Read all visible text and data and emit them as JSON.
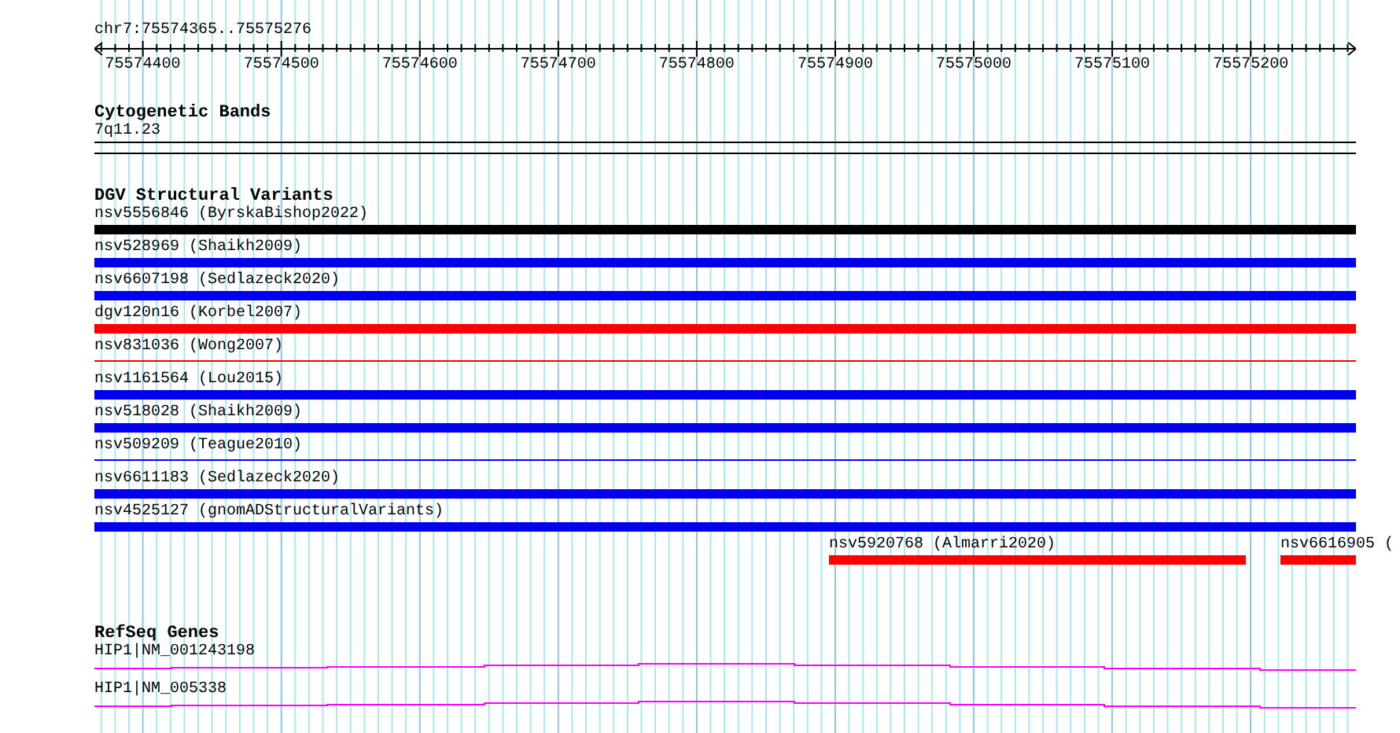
{
  "ruler": {
    "title": "chr7:75574365..75575276",
    "ticks": [
      "75574400",
      "75574500",
      "75574600",
      "75574700",
      "75574800",
      "75574900",
      "75575000",
      "75575100",
      "75575200"
    ]
  },
  "cytogenetic_bands": {
    "title": "Cytogenetic Bands",
    "band": "7q11.23"
  },
  "dgv_structural_variants": {
    "title": "DGV Structural Variants",
    "lanes": [
      [
        {
          "label": "nsv5556846 (ByrskaBishop2022)",
          "color": "#000000",
          "kind": "thick"
        }
      ],
      [
        {
          "label": "nsv528969 (Shaikh2009)",
          "color": "#0000ee",
          "kind": "thick"
        }
      ],
      [
        {
          "label": "nsv6607198 (Sedlazeck2020)",
          "color": "#0000ee",
          "kind": "thick"
        }
      ],
      [
        {
          "label": "dgv120n16 (Korbel2007)",
          "color": "#ff0000",
          "kind": "thick"
        }
      ],
      [
        {
          "label": "nsv831036 (Wong2007)",
          "color": "#ff0000",
          "kind": "thin"
        }
      ],
      [
        {
          "label": "nsv1161564 (Lou2015)",
          "color": "#0000ee",
          "kind": "thick"
        }
      ],
      [
        {
          "label": "nsv518028 (Shaikh2009)",
          "color": "#0000ee",
          "kind": "thick"
        }
      ],
      [
        {
          "label": "nsv509209 (Teague2010)",
          "color": "#0000ee",
          "kind": "thin"
        }
      ],
      [
        {
          "label": "nsv6611183 (Sedlazeck2020)",
          "color": "#0000ee",
          "kind": "thick"
        }
      ],
      [
        {
          "label": "nsv4525127 (gnomADStructuralVariants)",
          "color": "#0000ee",
          "kind": "thick"
        }
      ],
      [
        {
          "label": "nsv5920768 (Almarri2020)",
          "color": "#ff0000",
          "kind": "thick"
        },
        {
          "label": "nsv6616905 (",
          "color": "#ff0000",
          "kind": "thick"
        }
      ]
    ]
  },
  "refseq_genes": {
    "title": "RefSeq Genes",
    "transcripts": [
      {
        "label": "HIP1|NM_001243198"
      },
      {
        "label": "HIP1|NM_005338"
      }
    ]
  }
}
